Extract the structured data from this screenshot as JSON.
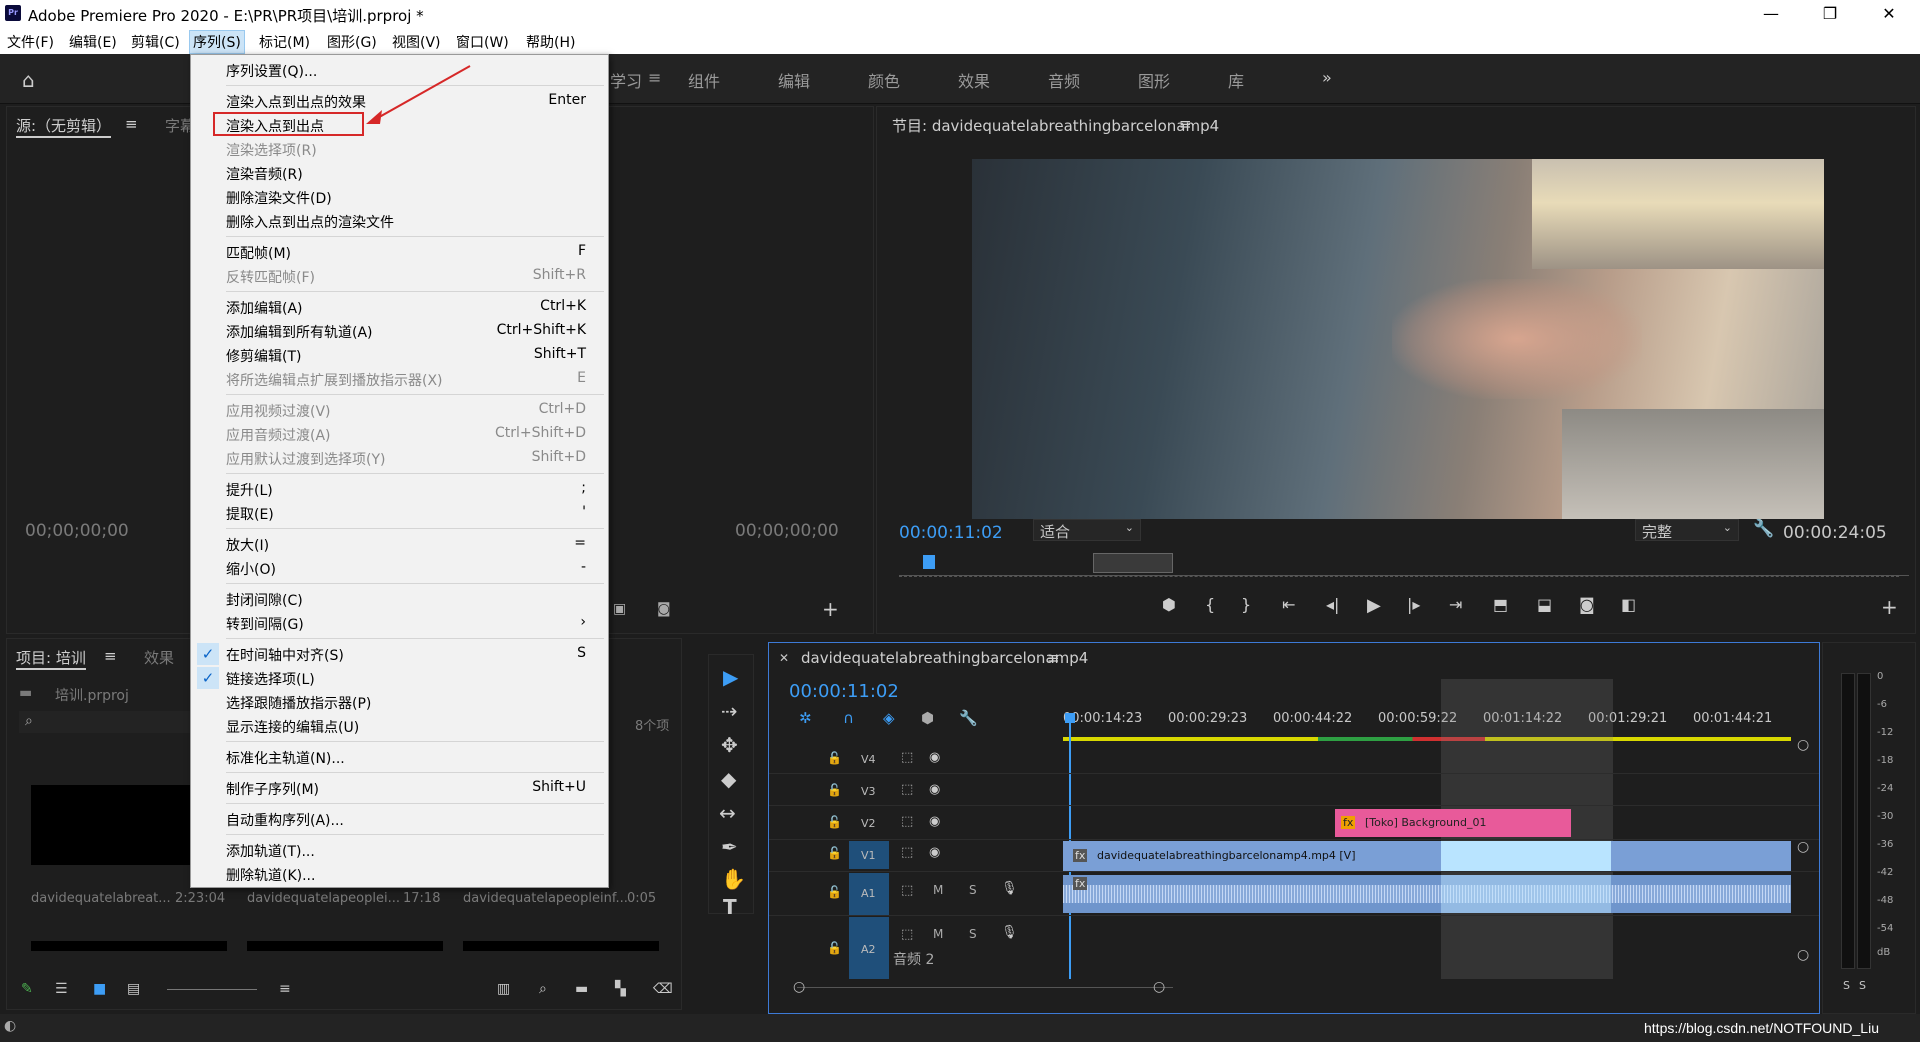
{
  "window": {
    "app_icon": "Pr",
    "title": "Adobe Premiere Pro 2020 - E:\\PR\\PR项目\\培训.prproj *",
    "minimize": "—",
    "maximize": "❐",
    "close": "✕"
  },
  "menubar": [
    "文件(F)",
    "编辑(E)",
    "剪辑(C)",
    "序列(S)",
    "标记(M)",
    "图形(G)",
    "视图(V)",
    "窗口(W)",
    "帮助(H)"
  ],
  "workspaces": {
    "partial": "学习",
    "items": [
      "组件",
      "编辑",
      "颜色",
      "效果",
      "音频",
      "图形",
      "库"
    ],
    "more": "»"
  },
  "sequence_menu": [
    {
      "label": "序列设置(Q)...",
      "shortcut": "",
      "disabled": false
    },
    {
      "sep": true
    },
    {
      "label": "渲染入点到出点的效果",
      "shortcut": "Enter",
      "disabled": false
    },
    {
      "label": "渲染入点到出点",
      "shortcut": "",
      "disabled": false
    },
    {
      "label": "渲染选择项(R)",
      "shortcut": "",
      "disabled": true
    },
    {
      "label": "渲染音频(R)",
      "shortcut": "",
      "disabled": false
    },
    {
      "label": "删除渲染文件(D)",
      "shortcut": "",
      "disabled": false
    },
    {
      "label": "删除入点到出点的渲染文件",
      "shortcut": "",
      "disabled": false
    },
    {
      "sep": true
    },
    {
      "label": "匹配帧(M)",
      "shortcut": "F",
      "disabled": false
    },
    {
      "label": "反转匹配帧(F)",
      "shortcut": "Shift+R",
      "disabled": true
    },
    {
      "sep": true
    },
    {
      "label": "添加编辑(A)",
      "shortcut": "Ctrl+K",
      "disabled": false
    },
    {
      "label": "添加编辑到所有轨道(A)",
      "shortcut": "Ctrl+Shift+K",
      "disabled": false
    },
    {
      "label": "修剪编辑(T)",
      "shortcut": "Shift+T",
      "disabled": false
    },
    {
      "label": "将所选编辑点扩展到播放指示器(X)",
      "shortcut": "E",
      "disabled": true
    },
    {
      "sep": true
    },
    {
      "label": "应用视频过渡(V)",
      "shortcut": "Ctrl+D",
      "disabled": true
    },
    {
      "label": "应用音频过渡(A)",
      "shortcut": "Ctrl+Shift+D",
      "disabled": true
    },
    {
      "label": "应用默认过渡到选择项(Y)",
      "shortcut": "Shift+D",
      "disabled": true
    },
    {
      "sep": true
    },
    {
      "label": "提升(L)",
      "shortcut": ";",
      "disabled": false
    },
    {
      "label": "提取(E)",
      "shortcut": "'",
      "disabled": false
    },
    {
      "sep": true
    },
    {
      "label": "放大(I)",
      "shortcut": "=",
      "disabled": false
    },
    {
      "label": "缩小(O)",
      "shortcut": "-",
      "disabled": false
    },
    {
      "sep": true
    },
    {
      "label": "封闭间隙(C)",
      "shortcut": "",
      "disabled": false
    },
    {
      "label": "转到间隔(G)",
      "shortcut": "›",
      "disabled": false
    },
    {
      "sep": true
    },
    {
      "label": "在时间轴中对齐(S)",
      "shortcut": "S",
      "disabled": false,
      "checked": true
    },
    {
      "label": "链接选择项(L)",
      "shortcut": "",
      "disabled": false,
      "checked": true
    },
    {
      "label": "选择跟随播放指示器(P)",
      "shortcut": "",
      "disabled": false
    },
    {
      "label": "显示连接的编辑点(U)",
      "shortcut": "",
      "disabled": false
    },
    {
      "sep": true
    },
    {
      "label": "标准化主轨道(N)...",
      "shortcut": "",
      "disabled": false
    },
    {
      "sep": true
    },
    {
      "label": "制作子序列(M)",
      "shortcut": "Shift+U",
      "disabled": false
    },
    {
      "sep": true
    },
    {
      "label": "自动重构序列(A)...",
      "shortcut": "",
      "disabled": false
    },
    {
      "sep": true
    },
    {
      "label": "添加轨道(T)...",
      "shortcut": "",
      "disabled": false
    },
    {
      "label": "删除轨道(K)...",
      "shortcut": "",
      "disabled": false
    }
  ],
  "source": {
    "tab": "源:（无剪辑）",
    "tab2": "字幕",
    "tc_left": "00;00;00;00",
    "tc_right": "00;00;00;00"
  },
  "program": {
    "tab": "节目: davidequatelabreathingbarcelonamp4",
    "timecode": "00:00:11:02",
    "fit": "适合",
    "quality": "完整",
    "duration": "00:00:24:05"
  },
  "project": {
    "tab": "项目: 培训",
    "tab2": "效果",
    "file": "培训.prproj",
    "count": "8个项",
    "items": [
      {
        "name": "davidequatelabreat...",
        "dur": "2:23:04"
      },
      {
        "name": "davidequatelapeoplei...",
        "dur": "17:18"
      },
      {
        "name": "davidequatelapeopleinf...",
        "dur": "0:05"
      }
    ]
  },
  "timeline": {
    "tab": "davidequatelabreathingbarcelonamp4",
    "timecode": "00:00:11:02",
    "ruler": [
      "00:00:14:23",
      "00:00:29:23",
      "00:00:44:22",
      "00:00:59:22",
      "00:01:14:22",
      "00:01:29:21",
      "00:01:44:21"
    ],
    "tracks": [
      "V4",
      "V3",
      "V2",
      "V1",
      "A1",
      "A2"
    ],
    "track_M": "M",
    "track_S": "S",
    "a2_name": "音频 2",
    "clip_v2": "[Toko] Background_01",
    "clip_v1": "davidequatelabreathingbarcelonamp4.mp4 [V]",
    "fx": "fx"
  },
  "meter": {
    "labels": [
      "0",
      "-6",
      "-12",
      "-18",
      "-24",
      "-30",
      "-36",
      "-42",
      "-48",
      "-54",
      "dB"
    ],
    "solo": "S"
  },
  "watermark": "https://blog.csdn.net/NOTFOUND_Liu",
  "colors": {
    "accent": "#3d9df5",
    "clip_v1": "#7a9fd6",
    "clip_v2": "#e85a9a",
    "highlight": "#d62828"
  }
}
